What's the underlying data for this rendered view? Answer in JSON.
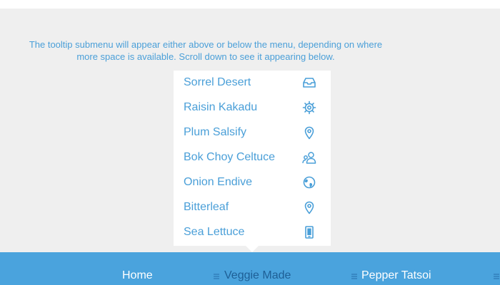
{
  "intro_text": "The tooltip submenu will appear either above or below the menu, depending on where more space is available. Scroll down to see it appearing below.",
  "colors": {
    "accent": "#4a9fd8",
    "menu_bar": "#4aa3dd",
    "active_label": "#1e5f96",
    "background": "#efefef"
  },
  "submenu": {
    "items": [
      {
        "label": "Sorrel Desert",
        "icon": "inbox-tray-icon"
      },
      {
        "label": "Raisin Kakadu",
        "icon": "gear-icon"
      },
      {
        "label": "Plum Salsify",
        "icon": "location-pin-icon"
      },
      {
        "label": "Bok Choy Celtuce",
        "icon": "users-icon"
      },
      {
        "label": "Onion Endive",
        "icon": "globe-icon"
      },
      {
        "label": "Bitterleaf",
        "icon": "location-pin-icon"
      },
      {
        "label": "Sea Lettuce",
        "icon": "mobile-phone-icon"
      }
    ]
  },
  "menu": {
    "items": [
      {
        "label": "Home",
        "has_submenu": false,
        "active": false
      },
      {
        "label": "Veggie Made",
        "has_submenu": true,
        "active": true
      },
      {
        "label": "Pepper Tatsoi",
        "has_submenu": true,
        "active": false
      },
      {
        "label": "",
        "has_submenu": true,
        "active": false
      }
    ]
  }
}
